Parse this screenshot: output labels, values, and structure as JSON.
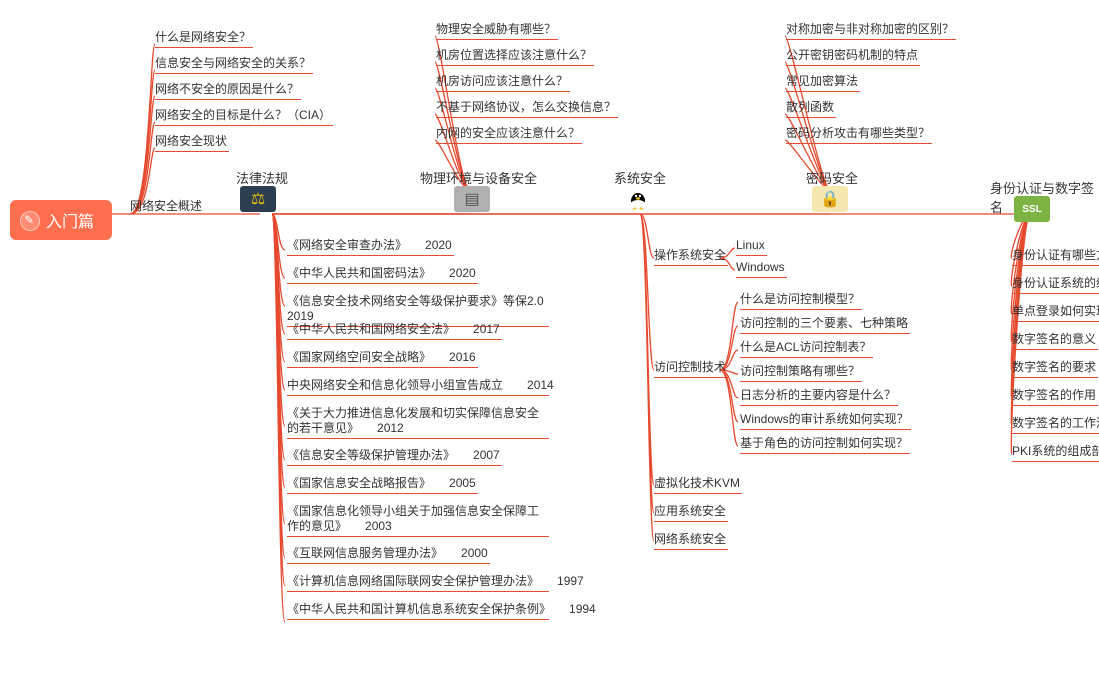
{
  "root": "入门篇",
  "overview": {
    "label": "网络安全概述",
    "items": [
      "什么是网络安全？",
      "信息安全与网络安全的关系？",
      "网络不安全的原因是什么？",
      "网络安全的目标是什么？（CIA）",
      "网络安全现状"
    ]
  },
  "branches": {
    "law": "法律法规",
    "env": "物理环境与设备安全",
    "sys": "系统安全",
    "pwd": "密码安全",
    "id": "身份认证与数字签名"
  },
  "laws": [
    {
      "t": "《网络安全审查办法》",
      "y": "2020"
    },
    {
      "t": "《中华人民共和国密码法》",
      "y": "2020"
    },
    {
      "t": "《信息安全技术网络安全等级保护要求》等保2.0",
      "y": "2019"
    },
    {
      "t": "《中华人民共和国网络安全法》",
      "y": "2017"
    },
    {
      "t": "《国家网络空间安全战略》",
      "y": "2016"
    },
    {
      "t": "中央网络安全和信息化领导小组宣告成立",
      "y": "2014"
    },
    {
      "t": "《关于大力推进信息化发展和切实保障信息安全的若干意见》",
      "y": "2012"
    },
    {
      "t": "《信息安全等级保护管理办法》",
      "y": "2007"
    },
    {
      "t": "《国家信息安全战略报告》",
      "y": "2005"
    },
    {
      "t": "《国家信息化领导小组关于加强信息安全保障工作的意见》",
      "y": "2003"
    },
    {
      "t": "《互联网信息服务管理办法》",
      "y": "2000"
    },
    {
      "t": "《计算机信息网络国际联网安全保护管理办法》",
      "y": "1997"
    },
    {
      "t": "《中华人民共和国计算机信息系统安全保护条例》",
      "y": "1994"
    }
  ],
  "env_items": [
    "物理安全威胁有哪些？",
    "机房位置选择应该注意什么？",
    "机房访问应该注意什么？",
    "不基于网络协议，怎么交换信息？",
    "内网的安全应该注意什么？"
  ],
  "sys": {
    "os": {
      "label": "操作系统安全",
      "items": [
        "Linux",
        "Windows"
      ]
    },
    "ac": {
      "label": "访问控制技术",
      "items": [
        "什么是访问控制模型？",
        "访问控制的三个要素、七种策略",
        "什么是ACL访问控制表？",
        "访问控制策略有哪些？",
        "日志分析的主要内容是什么？",
        "Windows的审计系统如何实现？",
        "基于角色的访问控制如何实现？"
      ]
    },
    "vm": "虚拟化技术KVM",
    "app": "应用系统安全",
    "net": "网络系统安全"
  },
  "pwd_items": [
    "对称加密与非对称加密的区别？",
    "公开密钥密码机制的特点",
    "常见加密算法",
    "散列函数",
    "密码分析攻击有哪些类型？"
  ],
  "id_items": [
    "身份认证有哪些方式？",
    "身份认证系统的组成？",
    "单点登录如何实现？",
    "数字签名的意义",
    "数字签名的要求",
    "数字签名的作用",
    "数字签名的工作流程",
    "PKI系统的组成部分"
  ],
  "chart_data": {
    "type": "mindmap",
    "root": "入门篇",
    "children": [
      {
        "label": "网络安全概述",
        "children_ref": "overview.items",
        "branches": [
          {
            "label": "法律法规",
            "children_ref": "laws"
          },
          {
            "label": "物理环境与设备安全",
            "children_ref": "env_items"
          },
          {
            "label": "系统安全",
            "children": [
              {
                "label": "操作系统安全",
                "children_ref": "sys.os.items"
              },
              {
                "label": "访问控制技术",
                "children_ref": "sys.ac.items"
              },
              {
                "label": "虚拟化技术KVM"
              },
              {
                "label": "应用系统安全"
              },
              {
                "label": "网络系统安全"
              }
            ]
          },
          {
            "label": "密码安全",
            "children_ref": "pwd_items"
          },
          {
            "label": "身份认证与数字签名",
            "children_ref": "id_items"
          }
        ]
      }
    ]
  }
}
